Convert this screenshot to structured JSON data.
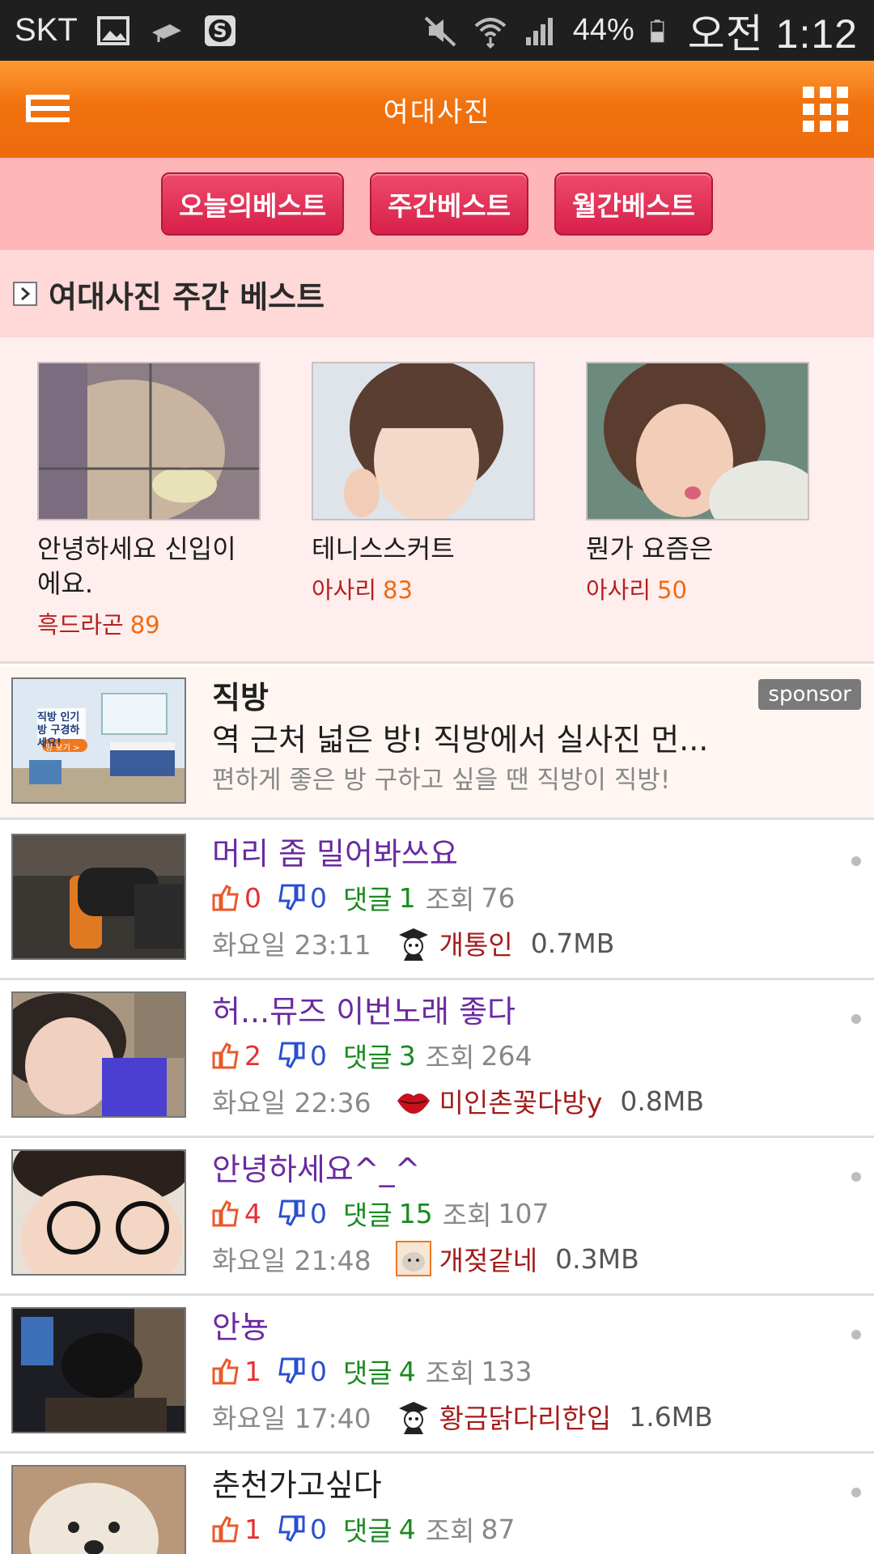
{
  "status_bar": {
    "carrier": "SKT",
    "battery": "44%",
    "time": "오전 1:12"
  },
  "header": {
    "title": "여대사진",
    "menu_icon": "menu-icon",
    "grid_icon": "grid-icon"
  },
  "tabs": [
    {
      "label": "오늘의베스트"
    },
    {
      "label": "주간베스트"
    },
    {
      "label": "월간베스트"
    }
  ],
  "section": {
    "title": "여대사진 주간 베스트"
  },
  "best": [
    {
      "caption": "안녕하세요 신입이 에요.",
      "author": "흑드라곤",
      "count": "89"
    },
    {
      "caption": "테니스스커트",
      "author": "아사리",
      "count": "83"
    },
    {
      "caption": "뭔가 요즘은",
      "author": "아사리",
      "count": "50"
    }
  ],
  "sponsor": {
    "name": "직방",
    "text": "역 근처 넓은 방! 직방에서 실사진 먼...",
    "sub": "편하게 좋은 방 구하고 싶을 땐 직방이 직방!",
    "badge": "sponsor",
    "thumb_text": "직방 인기방 구경하세요!",
    "thumb_button": "방 보기 >"
  },
  "posts": [
    {
      "title": "머리 좀 밀어봐쓰요",
      "likes": "0",
      "dislikes": "0",
      "comments_label": "댓글",
      "comments": "1",
      "views_label": "조회",
      "views": "76",
      "time": "화요일 23:11",
      "author": "개통인",
      "size": "0.7MB"
    },
    {
      "title": "허...뮤즈 이번노래 좋다",
      "likes": "2",
      "dislikes": "0",
      "comments_label": "댓글",
      "comments": "3",
      "views_label": "조회",
      "views": "264",
      "time": "화요일 22:36",
      "author": "미인촌꽃다방y",
      "size": "0.8MB"
    },
    {
      "title": "안녕하세요^_^",
      "likes": "4",
      "dislikes": "0",
      "comments_label": "댓글",
      "comments": "15",
      "views_label": "조회",
      "views": "107",
      "time": "화요일 21:48",
      "author": "개젖같네",
      "size": "0.3MB"
    },
    {
      "title": "안뇽",
      "likes": "1",
      "dislikes": "0",
      "comments_label": "댓글",
      "comments": "4",
      "views_label": "조회",
      "views": "133",
      "time": "화요일 17:40",
      "author": "황금닭다리한입",
      "size": "1.6MB"
    },
    {
      "title": "춘천가고싶다",
      "likes": "1",
      "dislikes": "0",
      "comments_label": "댓글",
      "comments": "4",
      "views_label": "조회",
      "views": "87"
    }
  ],
  "colors": {
    "appbar": "#f0720f",
    "tab_button": "#d7204a",
    "title_purple": "#6a2aa0",
    "like_red": "#e53030",
    "dislike_blue": "#2a4fd0",
    "comment_green": "#1a8a20",
    "author_red": "#a31c1c"
  }
}
